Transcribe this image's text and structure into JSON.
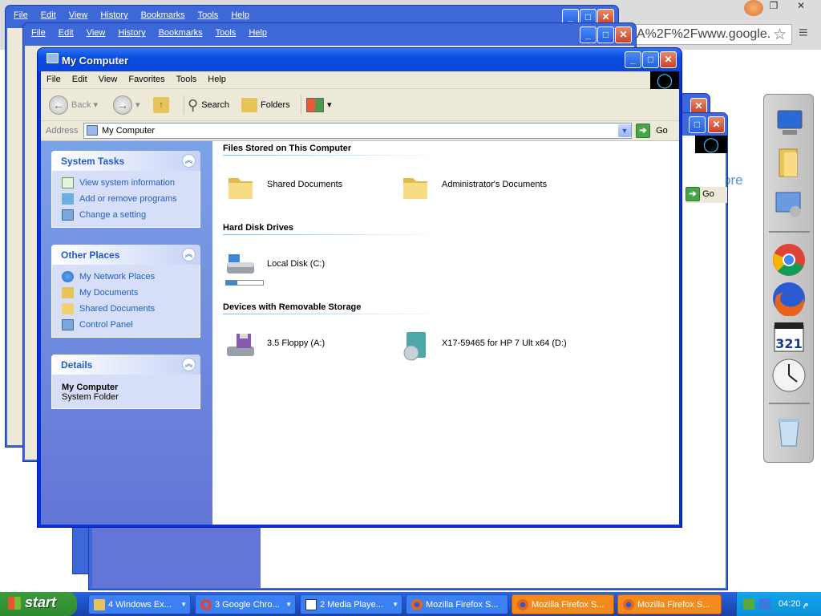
{
  "chrome": {
    "omnibox_text": "A%2F%2Fwww.google.",
    "more_text": "ore"
  },
  "bg_windows": {
    "menu": [
      "File",
      "Edit",
      "View",
      "History",
      "Bookmarks",
      "Tools",
      "Help"
    ],
    "go_label": "Go"
  },
  "window": {
    "title": "My Computer",
    "menu": [
      "File",
      "Edit",
      "View",
      "Favorites",
      "Tools",
      "Help"
    ],
    "toolbar": {
      "back": "Back",
      "search": "Search",
      "folders": "Folders"
    },
    "address": {
      "label": "Address",
      "value": "My Computer",
      "go": "Go"
    }
  },
  "taskpane": {
    "system_tasks": {
      "title": "System Tasks",
      "links": [
        "View system information",
        "Add or remove programs",
        "Change a setting"
      ]
    },
    "other_places": {
      "title": "Other Places",
      "links": [
        "My Network Places",
        "My Documents",
        "Shared Documents",
        "Control Panel"
      ]
    },
    "details": {
      "title": "Details",
      "name": "My Computer",
      "type": "System Folder"
    }
  },
  "content": {
    "groups": [
      {
        "title": "Files Stored on This Computer",
        "items": [
          "Shared Documents",
          "Administrator's Documents"
        ]
      },
      {
        "title": "Hard Disk Drives",
        "items": [
          "Local Disk (C:)"
        ]
      },
      {
        "title": "Devices with Removable Storage",
        "items": [
          "3.5 Floppy (A:)",
          "X17-59465 for HP 7 Ult x64 (D:)"
        ]
      }
    ],
    "disk_used_fraction": 0.3
  },
  "taskbar": {
    "start": "start",
    "tasks": [
      "4 Windows Ex...",
      "3 Google Chro...",
      "2 Media Playe...",
      "Mozilla Firefox S...",
      "Mozilla Firefox S...",
      "Mozilla Firefox S..."
    ],
    "clock": "04:20 م"
  }
}
